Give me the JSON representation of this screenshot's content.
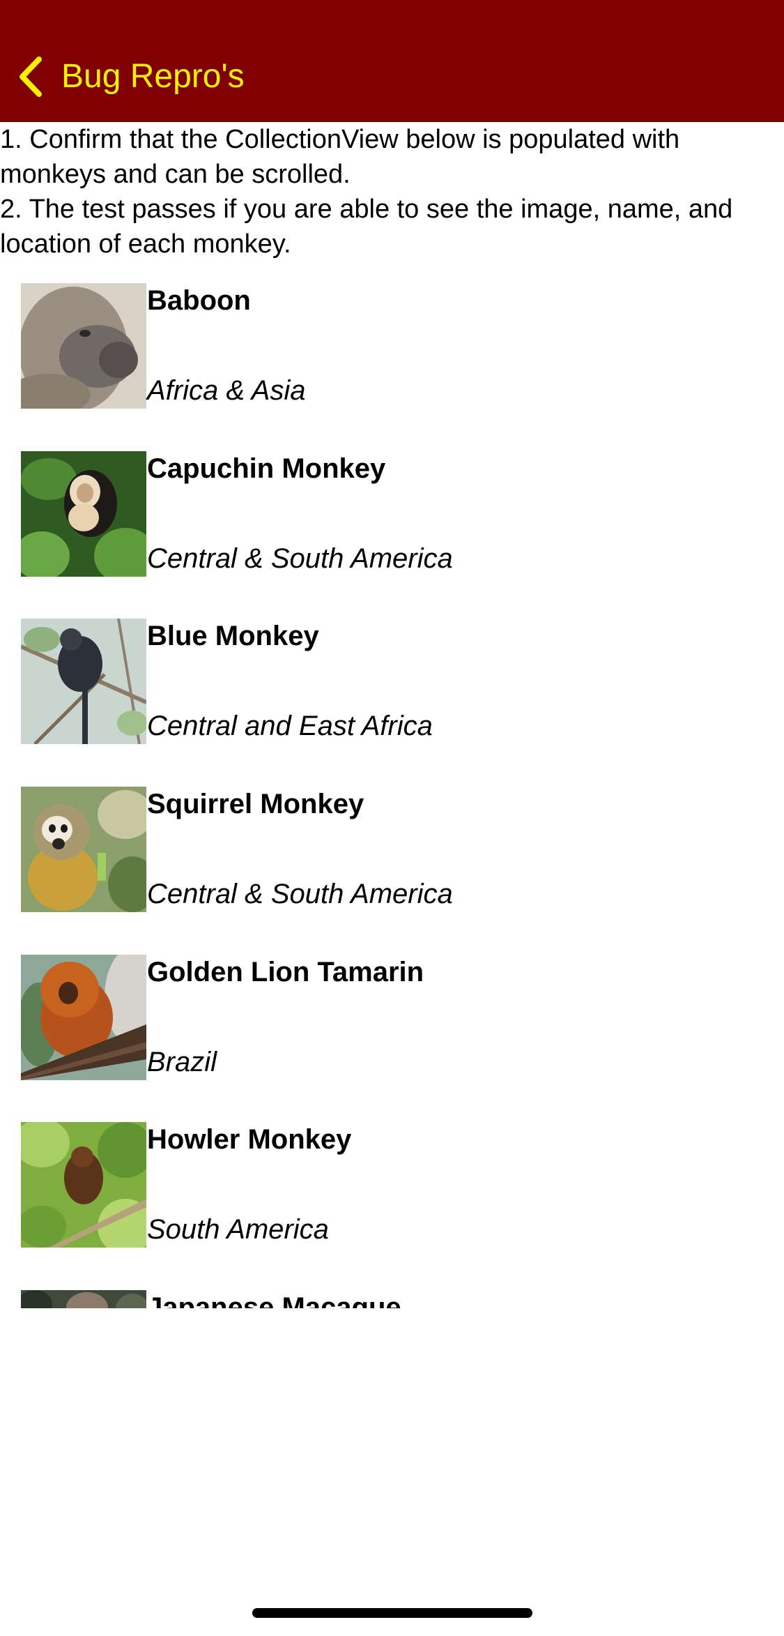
{
  "navbar": {
    "back_label": "Bug Repro's",
    "background_color": "#800000",
    "tint_color": "#FFF200",
    "back_icon": "chevron-left-icon"
  },
  "instructions": {
    "step1": "1. Confirm that the CollectionView below is populated with monkeys and can be scrolled.",
    "step2": "2. The test passes if you are able to see the image, name, and location of each monkey."
  },
  "monkeys": [
    {
      "name": "Baboon",
      "location": "Africa & Asia",
      "image": "baboon-photo"
    },
    {
      "name": "Capuchin Monkey",
      "location": "Central & South America",
      "image": "capuchin-monkey-photo"
    },
    {
      "name": "Blue Monkey",
      "location": "Central and East Africa",
      "image": "blue-monkey-photo"
    },
    {
      "name": "Squirrel Monkey",
      "location": "Central & South America",
      "image": "squirrel-monkey-photo"
    },
    {
      "name": "Golden Lion Tamarin",
      "location": "Brazil",
      "image": "golden-lion-tamarin-photo"
    },
    {
      "name": "Howler Monkey",
      "location": "South America",
      "image": "howler-monkey-photo"
    },
    {
      "name": "Japanese Macaque",
      "location": "",
      "image": "japanese-macaque-photo"
    }
  ]
}
